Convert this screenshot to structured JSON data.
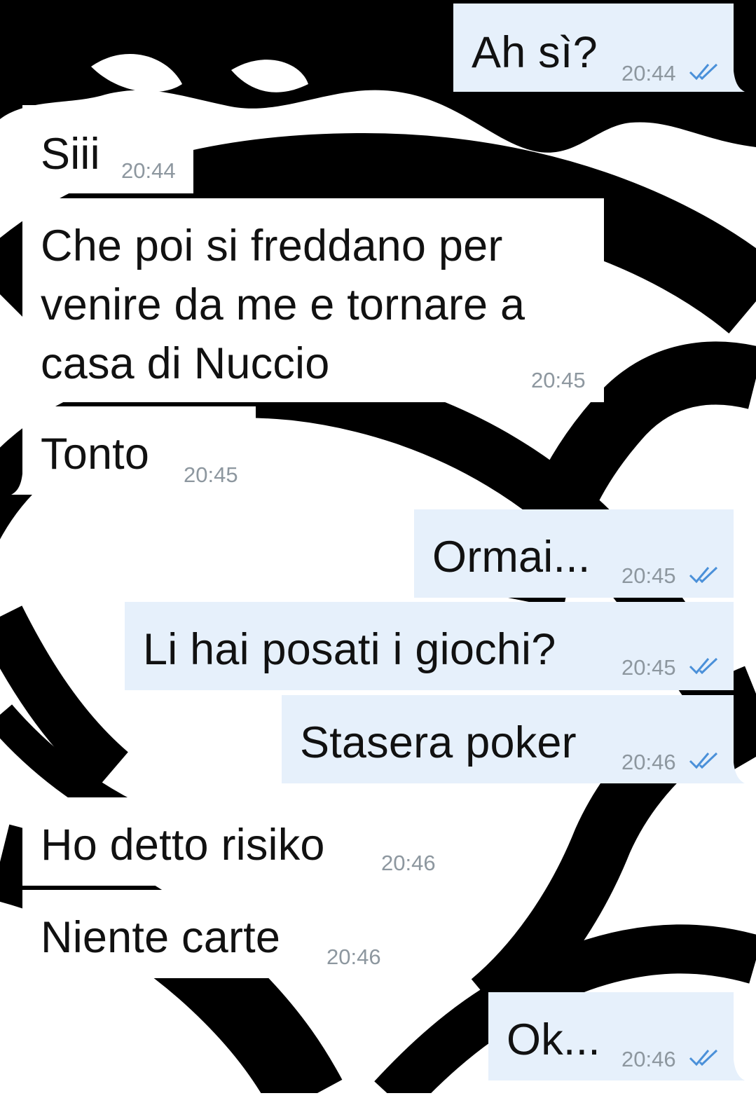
{
  "messages": [
    {
      "id": "m1",
      "direction": "out",
      "text": "Ah sì?",
      "time": "20:44",
      "status": "read"
    },
    {
      "id": "m2",
      "direction": "in",
      "text": "Siii",
      "time": "20:44"
    },
    {
      "id": "m3",
      "direction": "in",
      "text": "Che poi si freddano per\nvenire da me e tornare a\ncasa di Nuccio",
      "time": "20:45"
    },
    {
      "id": "m4",
      "direction": "in",
      "text": "Tonto",
      "time": "20:45"
    },
    {
      "id": "m5",
      "direction": "out",
      "text": "Ormai...",
      "time": "20:45",
      "status": "read"
    },
    {
      "id": "m6",
      "direction": "out",
      "text": "Li hai posati i giochi?",
      "time": "20:45",
      "status": "read"
    },
    {
      "id": "m7",
      "direction": "out",
      "text": "Stasera poker",
      "time": "20:46",
      "status": "read"
    },
    {
      "id": "m8",
      "direction": "in",
      "text": "Ho detto risiko",
      "time": "20:46"
    },
    {
      "id": "m9",
      "direction": "in",
      "text": "Niente carte",
      "time": "20:46"
    },
    {
      "id": "m10",
      "direction": "out",
      "text": "Ok...",
      "time": "20:46",
      "status": "read"
    }
  ],
  "colors": {
    "incoming_bubble": "#ffffff",
    "outgoing_bubble": "#e6f0fb",
    "read_ticks": "#4a90d9",
    "timestamp": "#8d979f",
    "wallpaper_dark": "#000000",
    "wallpaper_light": "#ffffff"
  },
  "icons": {
    "read_status": "double-check-icon",
    "wallpaper": "black-white-abstract-wallpaper"
  }
}
